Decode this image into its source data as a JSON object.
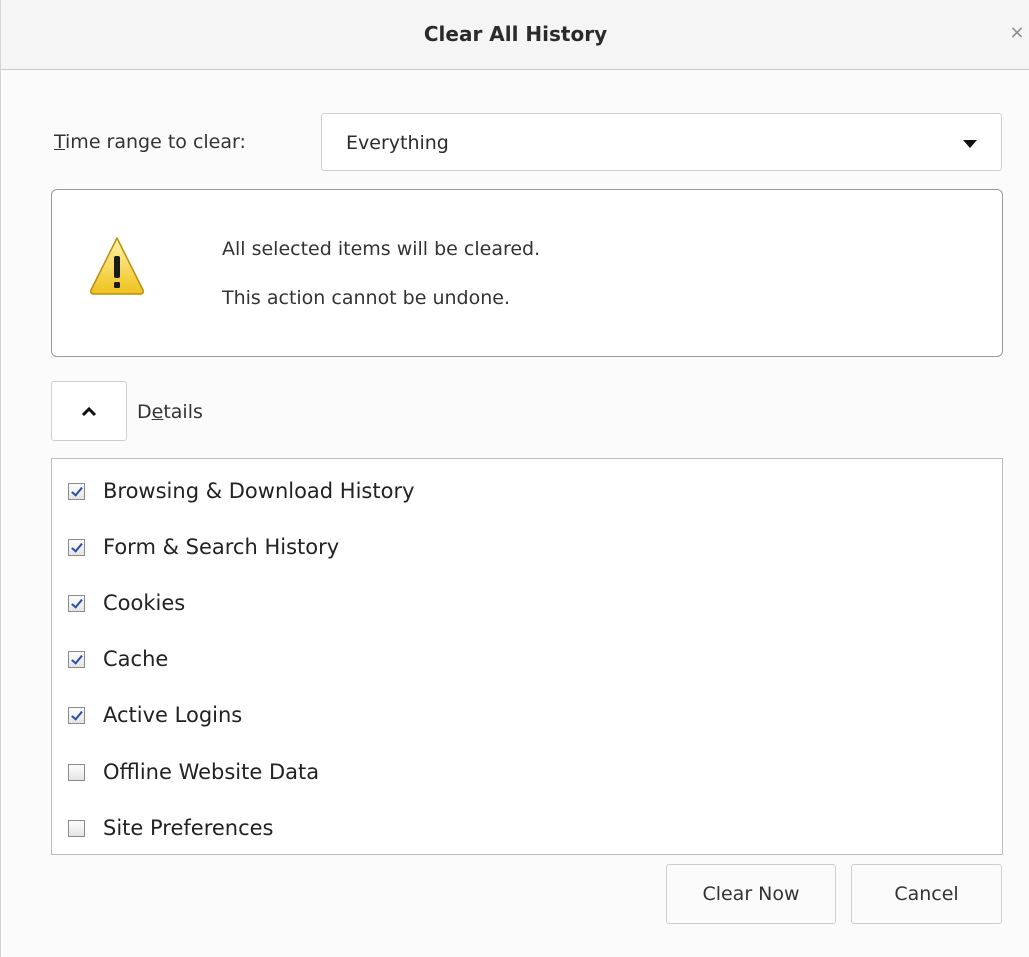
{
  "dialog": {
    "title": "Clear All History",
    "close_glyph": "×"
  },
  "time_range": {
    "label_accel": "T",
    "label_rest": "ime range to clear:",
    "selected": "Everything"
  },
  "warning": {
    "icon": "warning-icon",
    "line1": "All selected items will be cleared.",
    "line2": "This action cannot be undone."
  },
  "details": {
    "toggle_icon": "chevron-up-icon",
    "label_pre": "D",
    "label_accel": "e",
    "label_post": "tails",
    "expanded": true
  },
  "items": [
    {
      "label": "Browsing & Download History",
      "checked": true
    },
    {
      "label": "Form & Search History",
      "checked": true
    },
    {
      "label": "Cookies",
      "checked": true
    },
    {
      "label": "Cache",
      "checked": true
    },
    {
      "label": "Active Logins",
      "checked": true
    },
    {
      "label": "Offline Website Data",
      "checked": false
    },
    {
      "label": "Site Preferences",
      "checked": false
    }
  ],
  "buttons": {
    "clear_now": "Clear Now",
    "cancel": "Cancel"
  },
  "colors": {
    "check_mark": "#2a4fa8",
    "warning_yellow": "#f5d02a"
  }
}
